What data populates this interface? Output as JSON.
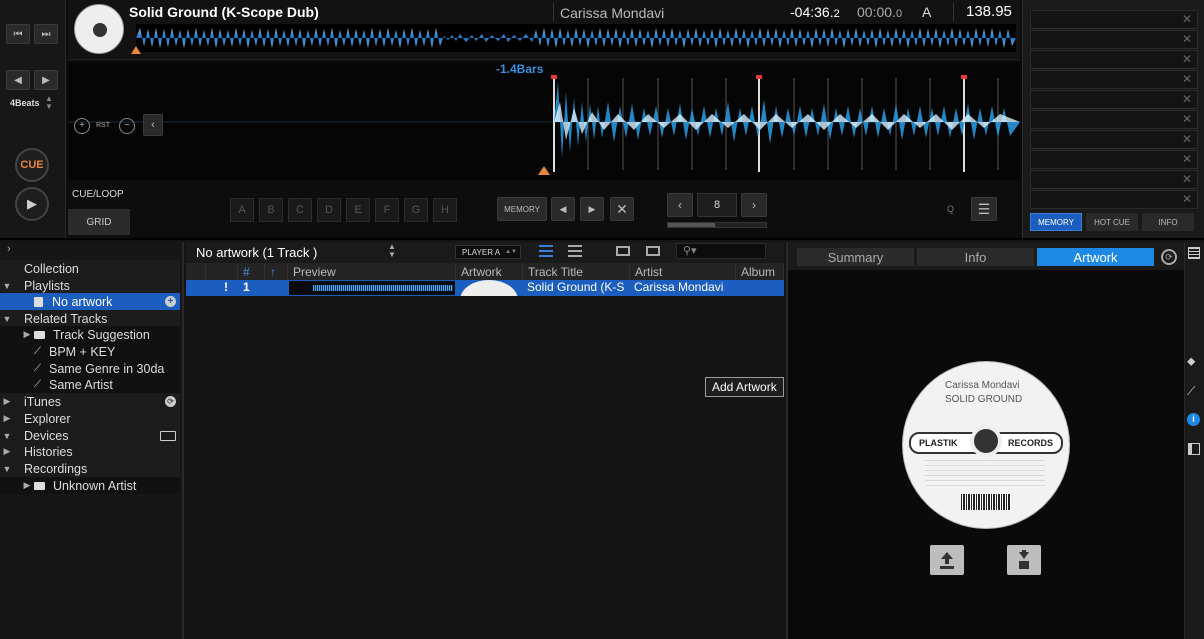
{
  "deck": {
    "title": "Solid Ground (K-Scope Dub)",
    "artist": "Carissa Mondavi",
    "remain_time": "-04:36",
    "remain_frac": "2",
    "elapsed_time": "00:00",
    "elapsed_frac": "0",
    "player": "A",
    "bpm": "138.95",
    "bars_offset": "-1.4Bars",
    "beat_size": "4Beats",
    "cue_label": "CUE",
    "rst_label": "RST",
    "cueloop_label": "CUE/LOOP",
    "grid_label": "GRID",
    "hotcues": [
      "A",
      "B",
      "C",
      "D",
      "E",
      "F",
      "G",
      "H"
    ],
    "memory_label": "MEMORY",
    "loop_beats": "8",
    "q_label": "Q",
    "right_tabs": [
      "MEMORY",
      "HOT CUE",
      "INFO"
    ]
  },
  "browser": {
    "current": "No artwork (1 Track )",
    "player_select": "PLAYER A",
    "columns": [
      "#",
      "Preview",
      "Artwork",
      "Track Title",
      "Artist",
      "Album"
    ],
    "rows": [
      {
        "flag": "!",
        "num": "1",
        "title": "Solid Ground (K-S",
        "artist": "Carissa Mondavi",
        "album": ""
      }
    ],
    "tooltip": "Add Artwork"
  },
  "tree": {
    "collection": "Collection",
    "playlists": "Playlists",
    "no_artwork": "No artwork",
    "related": "Related Tracks",
    "track_suggestion": "Track Suggestion",
    "bpm_key": "BPM + KEY",
    "same_genre": "Same Genre in 30da",
    "same_artist": "Same Artist",
    "itunes": "iTunes",
    "explorer": "Explorer",
    "devices": "Devices",
    "histories": "Histories",
    "recordings": "Recordings",
    "unknown_artist": "Unknown Artist"
  },
  "info_panel": {
    "tabs": [
      "Summary",
      "Info",
      "Artwork"
    ],
    "active_tab": "Artwork",
    "record_artist": "Carissa Mondavi",
    "record_title": "SOLID GROUND",
    "record_label_left": "PLASTIK",
    "record_label_right": "RECORDS"
  }
}
